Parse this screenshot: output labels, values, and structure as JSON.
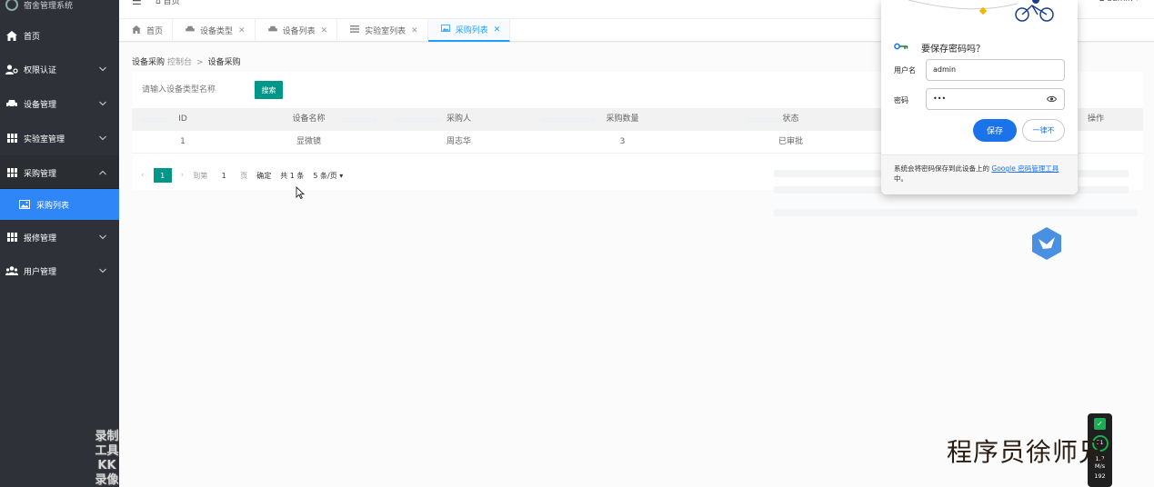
{
  "app": {
    "title": "宿舍管理系统"
  },
  "topbar": {
    "toggle_icon": "menu-icon",
    "home": "首页",
    "user": "admin"
  },
  "sidebar": {
    "items": [
      {
        "label": "首页",
        "icon": "home-icon",
        "chevron": ""
      },
      {
        "label": "权限认证",
        "icon": "user-key-icon",
        "chevron": "⌄"
      },
      {
        "label": "设备管理",
        "icon": "car-icon",
        "chevron": "⌄"
      },
      {
        "label": "实验室管理",
        "icon": "grid-icon",
        "chevron": "⌄"
      },
      {
        "label": "采购管理",
        "icon": "grid-icon",
        "chevron": "⌃"
      },
      {
        "label": "报修管理",
        "icon": "grid-icon",
        "chevron": "⌄"
      },
      {
        "label": "用户管理",
        "icon": "users-icon",
        "chevron": "⌄"
      }
    ],
    "subitem": {
      "label": "采购列表",
      "icon": "image-icon"
    }
  },
  "tabs": [
    {
      "label": "首页",
      "icon": "home-icon",
      "closable": false
    },
    {
      "label": "设备类型",
      "icon": "car-icon",
      "closable": true
    },
    {
      "label": "设备列表",
      "icon": "car-icon",
      "closable": true
    },
    {
      "label": "实验室列表",
      "icon": "list-icon",
      "closable": true
    },
    {
      "label": "采购列表",
      "icon": "image-icon",
      "closable": true,
      "active": true
    }
  ],
  "breadcrumb": {
    "title": "设备采购",
    "subtitle": "控制台",
    "separator": ">",
    "current": "设备采购"
  },
  "search": {
    "placeholder": "请输入设备类型名称",
    "button": "搜索"
  },
  "table": {
    "headers": [
      "ID",
      "设备名称",
      "采购人",
      "采购数量",
      "状态",
      "操作"
    ],
    "rows": [
      [
        "1",
        "显微镜",
        "周志华",
        "3",
        "已审批",
        ""
      ]
    ]
  },
  "pager": {
    "prev": "‹",
    "current": "1",
    "next": "›",
    "goto": "到第",
    "goto_value": "1",
    "page_unit": "页",
    "ok": "确定",
    "total": "共 1 条",
    "page_size": "5 条/页"
  },
  "password_popup": {
    "title": "要保存密码吗？",
    "username_label": "用户名",
    "username_value": "admin",
    "password_label": "密码",
    "password_value": "•••",
    "save": "保存",
    "never": "一律不",
    "footer_text": "系统会将密码保存到此设备上的 ",
    "footer_link": "Google 密码管理工具",
    "footer_end": "中。"
  },
  "recorder_watermark": {
    "line1": "录制工具",
    "line2": "KK录像机"
  },
  "net_monitor": {
    "percent": "51",
    "speed": "1.7",
    "unit": "M/s",
    "bottom": "192"
  },
  "author_watermark": "程序员徐师兄",
  "colors": {
    "sidebar": "#2e3238",
    "accent": "#1e9fff",
    "primary_button": "#009688",
    "active_subitem": "#2f86f6",
    "chrome_blue": "#1a73e8"
  }
}
